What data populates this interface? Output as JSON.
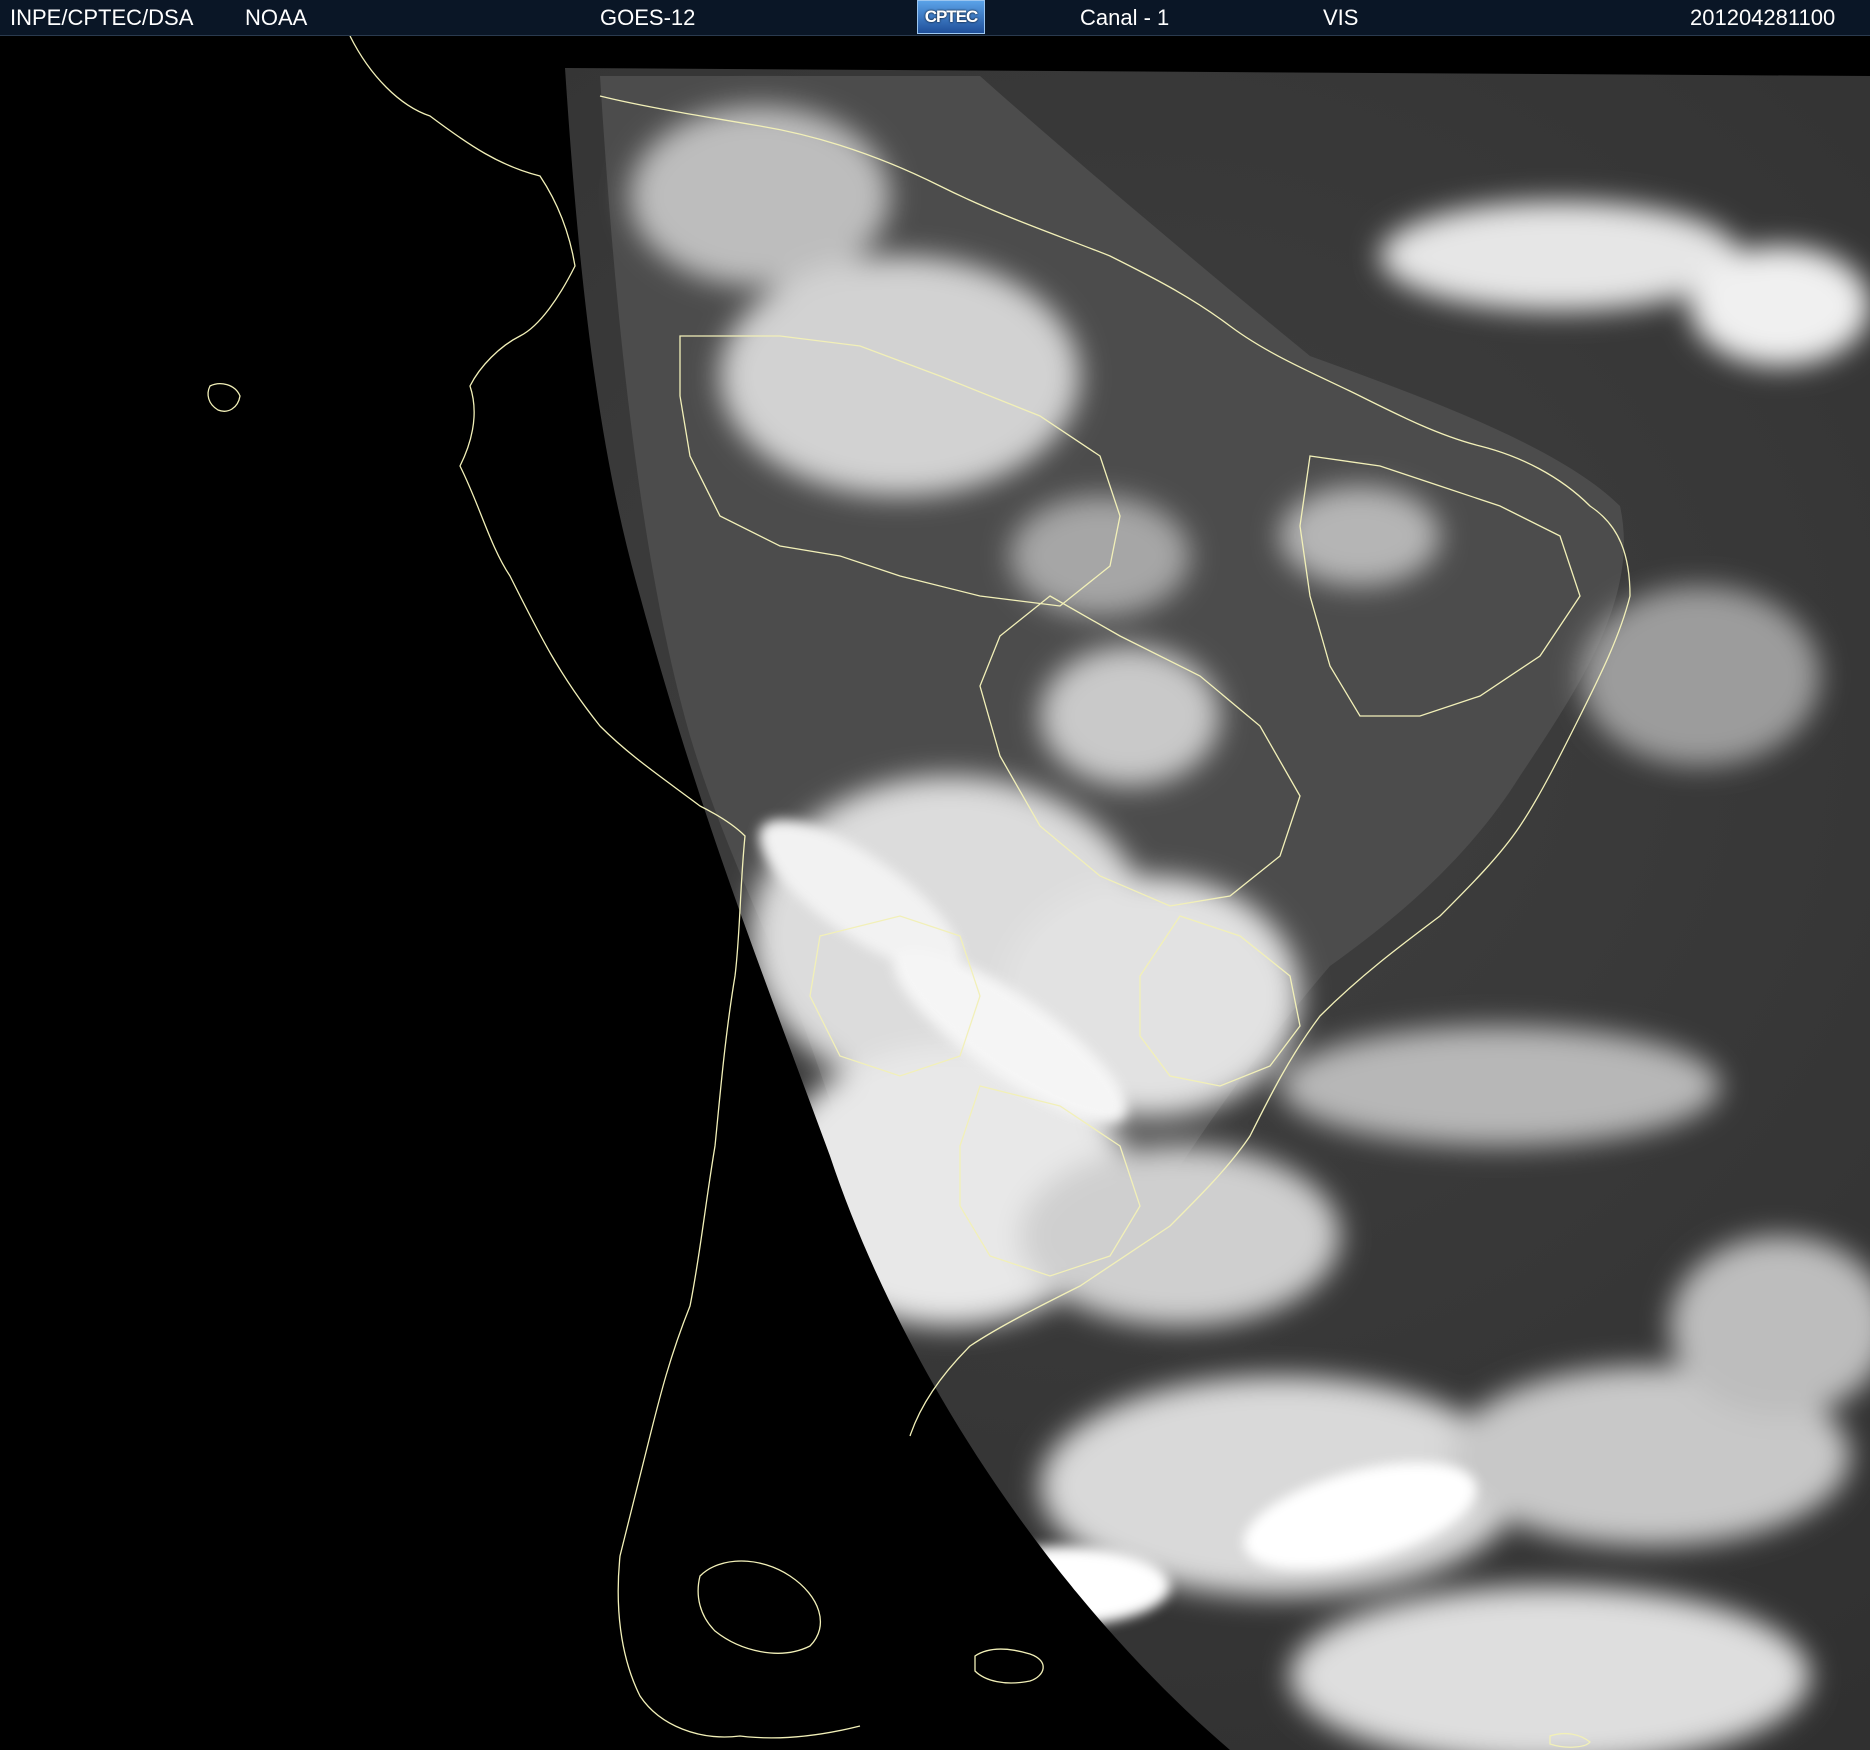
{
  "header": {
    "institution": "INPE/CPTEC/DSA",
    "agency": "NOAA",
    "satellite": "GOES-12",
    "logo_text": "CPTEC",
    "channel": "Canal - 1",
    "band": "VIS",
    "timestamp": "201204281100"
  },
  "map": {
    "imagery": "visible-satellite-cloud-cover",
    "background_color": "#000000",
    "land_color": "#5a5a5a",
    "ocean_color": "#3a3a3a",
    "cloud_color": "#e8e8e8",
    "border_color": "#f2f0b8",
    "header_color": "#0a1626"
  }
}
